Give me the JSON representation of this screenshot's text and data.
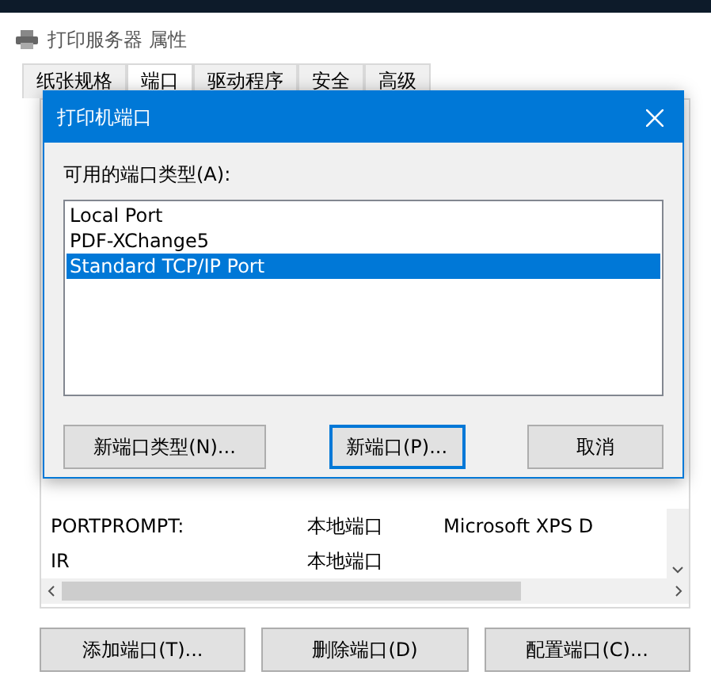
{
  "window": {
    "title": "打印服务器 属性"
  },
  "tabs": [
    {
      "label": "纸张规格",
      "selected": false
    },
    {
      "label": "端口",
      "selected": true
    },
    {
      "label": "驱动程序",
      "selected": false
    },
    {
      "label": "安全",
      "selected": false
    },
    {
      "label": "高级",
      "selected": false
    }
  ],
  "ports_table": {
    "rows": [
      {
        "cells": [
          "PORTPROMPT:",
          "本地端口",
          "Microsoft XPS D"
        ]
      },
      {
        "cells": [
          "IR",
          "本地端口",
          ""
        ]
      }
    ]
  },
  "buttons": [
    "添加端口(T)...",
    "删除端口(D)",
    "配置端口(C)..."
  ],
  "dialog": {
    "title": "打印机端口",
    "label": "可用的端口类型(A):",
    "port_types": [
      {
        "label": "Local Port",
        "selected": false
      },
      {
        "label": "PDF-XChange5",
        "selected": false
      },
      {
        "label": "Standard TCP/IP Port",
        "selected": true
      }
    ],
    "buttons": [
      {
        "label": "新端口类型(N)...",
        "focused": false
      },
      {
        "label": "新端口(P)...",
        "focused": true
      },
      {
        "label": "取消",
        "focused": false
      }
    ]
  }
}
